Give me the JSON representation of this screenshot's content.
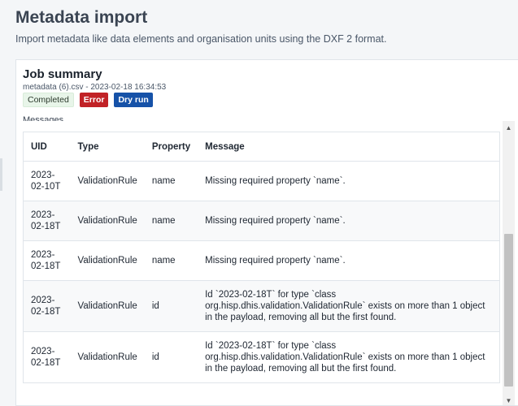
{
  "page": {
    "title": "Metadata import",
    "subtitle": "Import metadata like data elements and organisation units using the DXF 2 format."
  },
  "job": {
    "title": "Job summary",
    "meta": "metadata (6).csv - 2023-02-18 16:34:53",
    "tags": {
      "completed": "Completed",
      "error": "Error",
      "dry_run": "Dry run"
    }
  },
  "messages": {
    "label": "Messages",
    "columns": [
      "UID",
      "Type",
      "Property",
      "Message"
    ],
    "rows": [
      {
        "uid": "2023-02-10T",
        "type": "ValidationRule",
        "property": "name",
        "message": "Missing required property `name`."
      },
      {
        "uid": "2023-02-18T",
        "type": "ValidationRule",
        "property": "name",
        "message": "Missing required property `name`."
      },
      {
        "uid": "2023-02-18T",
        "type": "ValidationRule",
        "property": "name",
        "message": "Missing required property `name`."
      },
      {
        "uid": "2023-02-18T",
        "type": "ValidationRule",
        "property": "id",
        "message": "Id `2023-02-18T` for type `class org.hisp.dhis.validation.ValidationRule` exists on more than 1 object in the payload, removing all but the first found."
      },
      {
        "uid": "2023-02-18T",
        "type": "ValidationRule",
        "property": "id",
        "message": "Id `2023-02-18T` for type `class org.hisp.dhis.validation.ValidationRule` exists on more than 1 object in the payload, removing all but the first found."
      }
    ]
  },
  "icons": {
    "scroll_up": "triangle-up-icon",
    "scroll_down": "triangle-down-icon"
  },
  "colors": {
    "error": "#c12226",
    "dry_run": "#1652a8",
    "completed_bg": "#e8f5e9"
  }
}
